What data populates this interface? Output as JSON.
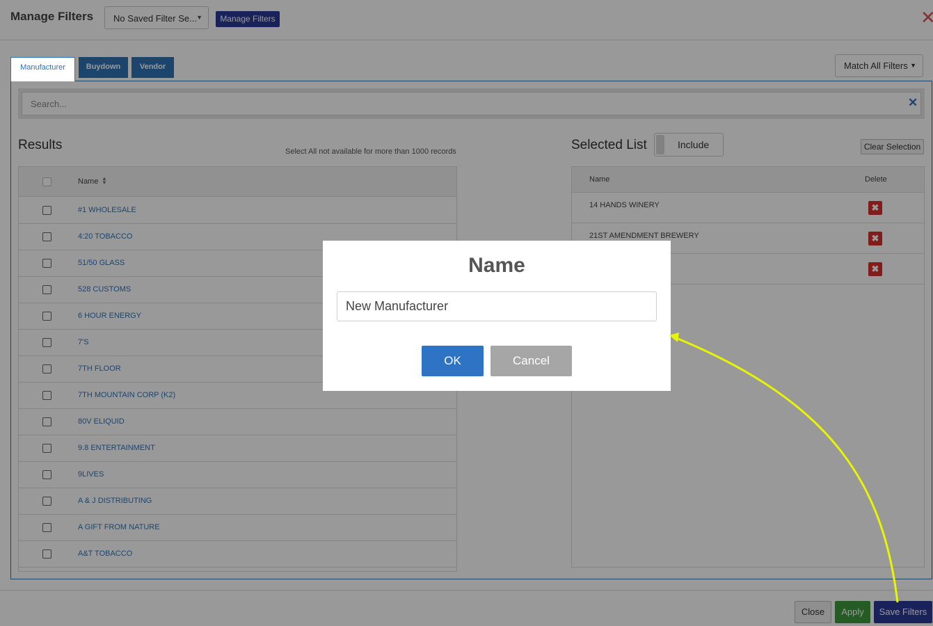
{
  "header": {
    "title": "Manage Filters",
    "saved_filter_value": "No Saved Filter Se...",
    "manage_filters_label": "Manage Filters",
    "close_glyph": "✕"
  },
  "tabs": [
    {
      "label": "Manufacturer",
      "active": true
    },
    {
      "label": "Buydown",
      "active": false
    },
    {
      "label": "Vendor",
      "active": false
    }
  ],
  "match_filter": {
    "value": "Match All Filters"
  },
  "search": {
    "placeholder": "Search...",
    "clear_glyph": "✕"
  },
  "results": {
    "title": "Results",
    "note": "Select All not available for more than 1000 records",
    "column_name": "Name",
    "rows": [
      "#1 WHOLESALE",
      "4:20 TOBACCO",
      "51/50 GLASS",
      "528 CUSTOMS",
      "6 HOUR ENERGY",
      "7'S",
      "7TH FLOOR",
      "7TH MOUNTAIN CORP (K2)",
      "80V ELIQUID",
      "9.8 ENTERTAINMENT",
      "9LIVES",
      "A & J DISTRIBUTING",
      "A GIFT FROM NATURE",
      "A&T TOBACCO"
    ]
  },
  "selected": {
    "title": "Selected List",
    "include_label": "Include",
    "clear_label": "Clear Selection",
    "col_name": "Name",
    "col_delete": "Delete",
    "rows": [
      "14 HANDS WINERY",
      "21ST AMENDMENT BREWERY",
      ""
    ],
    "delete_glyph": "✖"
  },
  "footer": {
    "close_label": "Close",
    "apply_label": "Apply",
    "save_label": "Save Filters"
  },
  "modal": {
    "title": "Name",
    "input_value": "New Manufacturer",
    "ok_label": "OK",
    "cancel_label": "Cancel"
  },
  "colors": {
    "accent_blue": "#2f74b8",
    "navy": "#2b3a96",
    "apply_green": "#3e9a3e",
    "delete_red": "#d9302c",
    "annotation_arrow": "#e8f500"
  }
}
